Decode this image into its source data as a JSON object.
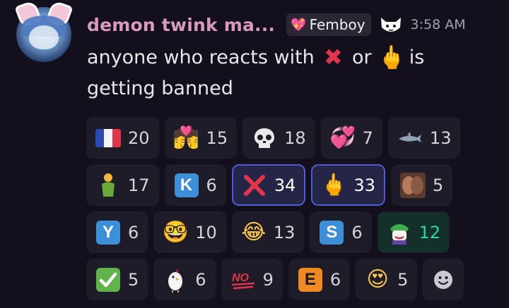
{
  "message": {
    "username": "demon twink ma...",
    "role": "Femboy",
    "timestamp": "3:58 AM",
    "text_part1": "anyone who reacts with ",
    "text_part2": " or ",
    "text_part3": " is getting banned"
  },
  "colors": {
    "background": "#130f1c",
    "username": "#d99ac0",
    "reaction_bg": "#1f1c29",
    "reaction_active_border": "#4f5bd5",
    "teal_count": "#35d39c"
  },
  "reactions": [
    [
      {
        "icon": "france-flag-icon",
        "count": "20"
      },
      {
        "icon": "kissing-couple-icon",
        "count": "15"
      },
      {
        "icon": "skull-icon",
        "count": "18"
      },
      {
        "icon": "heart-with-ribbon-icon",
        "count": "7"
      },
      {
        "icon": "shark-icon",
        "count": "13"
      }
    ],
    [
      {
        "icon": "person-icon",
        "count": "17"
      },
      {
        "icon": "letter-k-icon",
        "count": "6"
      },
      {
        "icon": "cross-mark-icon",
        "count": "34",
        "active": true
      },
      {
        "icon": "middle-finger-icon",
        "count": "33",
        "active": true
      },
      {
        "icon": "kissing-photo-icon",
        "count": "5"
      }
    ],
    [
      {
        "icon": "letter-y-icon",
        "count": "6"
      },
      {
        "icon": "nerd-face-icon",
        "count": "10"
      },
      {
        "icon": "tears-of-joy-icon",
        "count": "13"
      },
      {
        "icon": "letter-s-icon",
        "count": "6"
      },
      {
        "icon": "joker-icon",
        "count": "12",
        "teal": true
      }
    ],
    [
      {
        "icon": "check-mark-icon",
        "count": "5"
      },
      {
        "icon": "chicken-icon",
        "count": "6"
      },
      {
        "icon": "hundred-no-icon",
        "count": "9"
      },
      {
        "icon": "letter-e-icon",
        "count": "6"
      },
      {
        "icon": "heart-eyes-icon",
        "count": "5"
      },
      {
        "icon": "add-reaction-icon",
        "count": ""
      }
    ]
  ]
}
